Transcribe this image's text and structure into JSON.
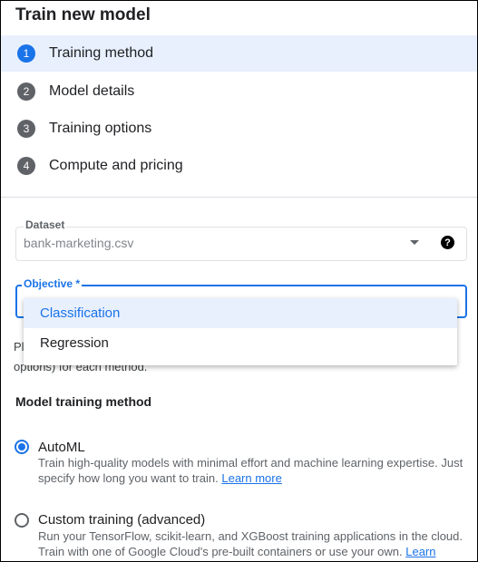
{
  "header": {
    "title": "Train new model"
  },
  "steps": [
    {
      "num": "1",
      "label": "Training method"
    },
    {
      "num": "2",
      "label": "Model details"
    },
    {
      "num": "3",
      "label": "Training options"
    },
    {
      "num": "4",
      "label": "Compute and pricing"
    }
  ],
  "dataset": {
    "label": "Dataset",
    "value": "bank-marketing.csv",
    "help": "?"
  },
  "objective": {
    "label": "Objective *",
    "options": [
      "Classification",
      "Regression"
    ],
    "highlighted": "Classification"
  },
  "partial_text": {
    "line1_prefix": "Pl",
    "line2": "options) for each method."
  },
  "training": {
    "section_title": "Model training method",
    "automl": {
      "label": "AutoML",
      "desc": "Train high-quality models with minimal effort and machine learning expertise. Just specify how long you want to train.",
      "link": "Learn more"
    },
    "custom": {
      "label": "Custom training (advanced)",
      "desc": "Run your TensorFlow, scikit-learn, and XGBoost training applications in the cloud. Train with one of Google Cloud's pre-built containers or use your own.",
      "link": "Learn more"
    }
  },
  "colors": {
    "accent": "#1a73e8",
    "active_bg": "#e8f0fe",
    "step_circle": "#5f6368"
  }
}
